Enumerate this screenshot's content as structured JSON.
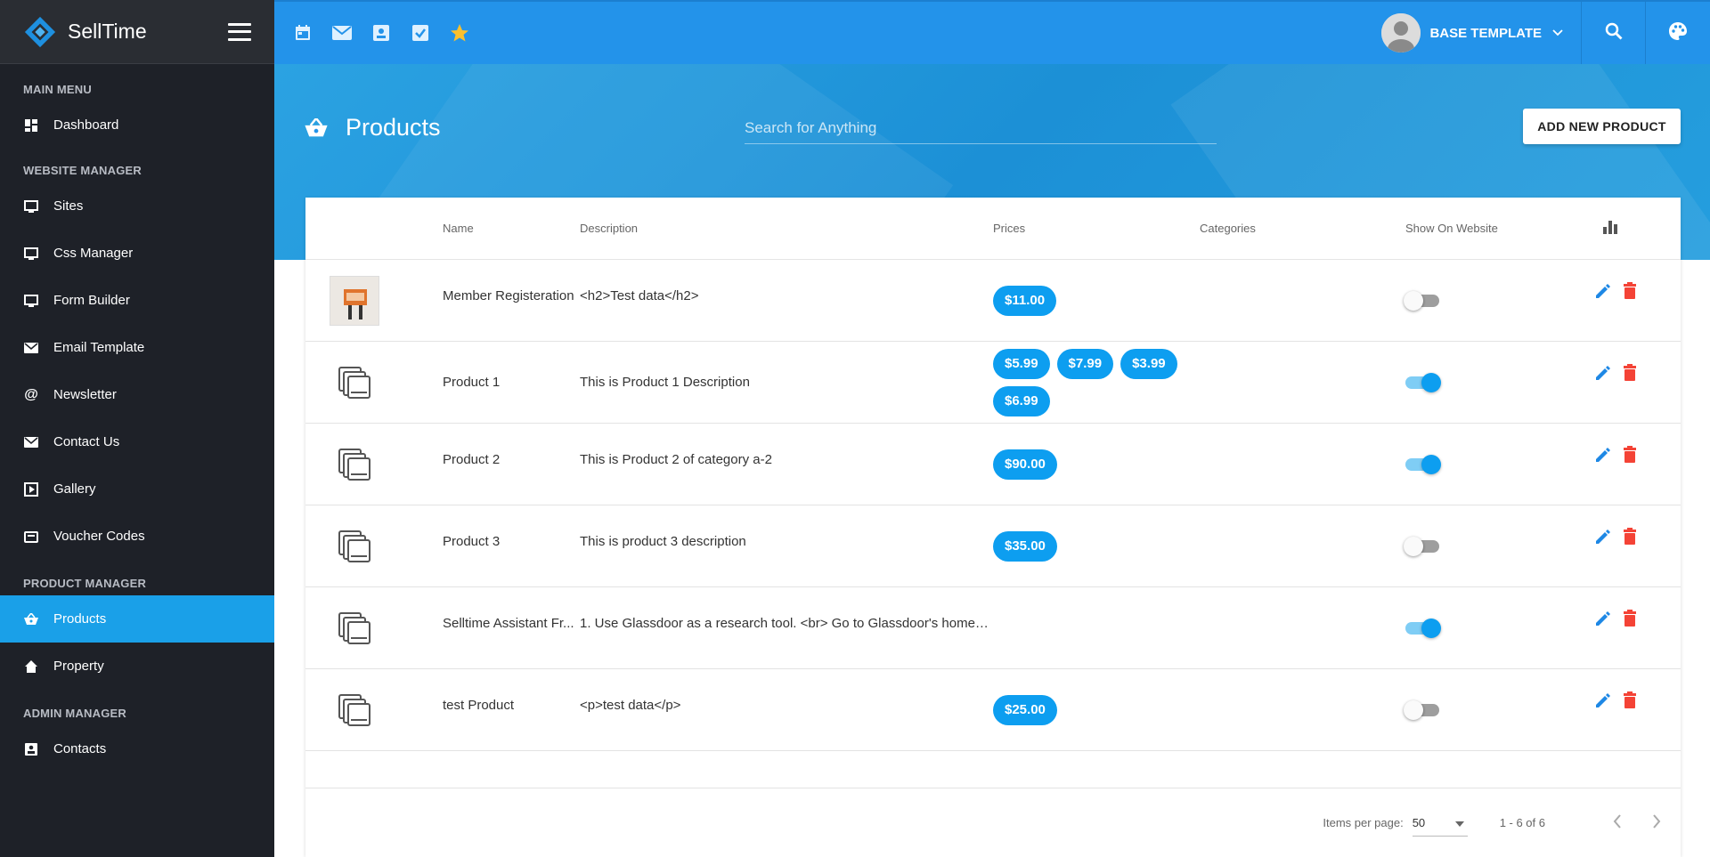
{
  "app": {
    "name": "SellTime"
  },
  "sidebar": {
    "sections": {
      "main": "MAIN MENU",
      "website": "WEBSITE MANAGER",
      "product": "PRODUCT MANAGER",
      "admin": "ADMIN MANAGER"
    },
    "items": {
      "dashboard": "Dashboard",
      "sites": "Sites",
      "css_manager": "Css Manager",
      "form_builder": "Form Builder",
      "email_template": "Email Template",
      "newsletter": "Newsletter",
      "contact_us": "Contact Us",
      "gallery": "Gallery",
      "voucher_codes": "Voucher Codes",
      "products": "Products",
      "property": "Property",
      "contacts": "Contacts"
    },
    "active": "products",
    "active_color": "#1aa0e8"
  },
  "topbar": {
    "icons": [
      "calendar-icon",
      "mail-icon",
      "contact-card-icon",
      "checkbox-icon",
      "star-icon"
    ],
    "user_name": "BASE TEMPLATE"
  },
  "page": {
    "title": "Products",
    "search_placeholder": "Search for Anything",
    "add_button": "ADD NEW PRODUCT"
  },
  "table": {
    "headers": {
      "name": "Name",
      "description": "Description",
      "prices": "Prices",
      "categories": "Categories",
      "show": "Show On Website"
    },
    "rows": [
      {
        "name": "Member Registeration",
        "description": "<h2>Test data</h2>",
        "prices": [
          "$11.00"
        ],
        "categories": "",
        "show": false,
        "image": "photo"
      },
      {
        "name": "Product 1",
        "description": "This is Product 1 Description",
        "prices": [
          "$5.99",
          "$7.99",
          "$3.99",
          "$6.99"
        ],
        "categories": "",
        "show": true,
        "image": "placeholder"
      },
      {
        "name": "Product 2",
        "description": "This is Product 2 of category a-2",
        "prices": [
          "$90.00"
        ],
        "categories": "",
        "show": true,
        "image": "placeholder"
      },
      {
        "name": "Product 3",
        "description": "This is product 3 description",
        "prices": [
          "$35.00"
        ],
        "categories": "",
        "show": false,
        "image": "placeholder"
      },
      {
        "name": "Selltime Assistant Fr...",
        "description": "1. Use Glassdoor as a research tool. <br> Go to Glassdoor's home p...",
        "prices": [],
        "categories": "",
        "show": true,
        "image": "placeholder"
      },
      {
        "name": "test Product",
        "description": "<p>test data</p>",
        "prices": [
          "$25.00"
        ],
        "categories": "",
        "show": false,
        "image": "placeholder"
      }
    ]
  },
  "pagination": {
    "items_per_page_label": "Items per page:",
    "items_per_page": "50",
    "range": "1 - 6 of 6"
  },
  "colors": {
    "topbar": "#2393ea",
    "price_pill": "#0d9ef0",
    "edit_icon": "#1e88e5",
    "delete_icon": "#f44336"
  }
}
